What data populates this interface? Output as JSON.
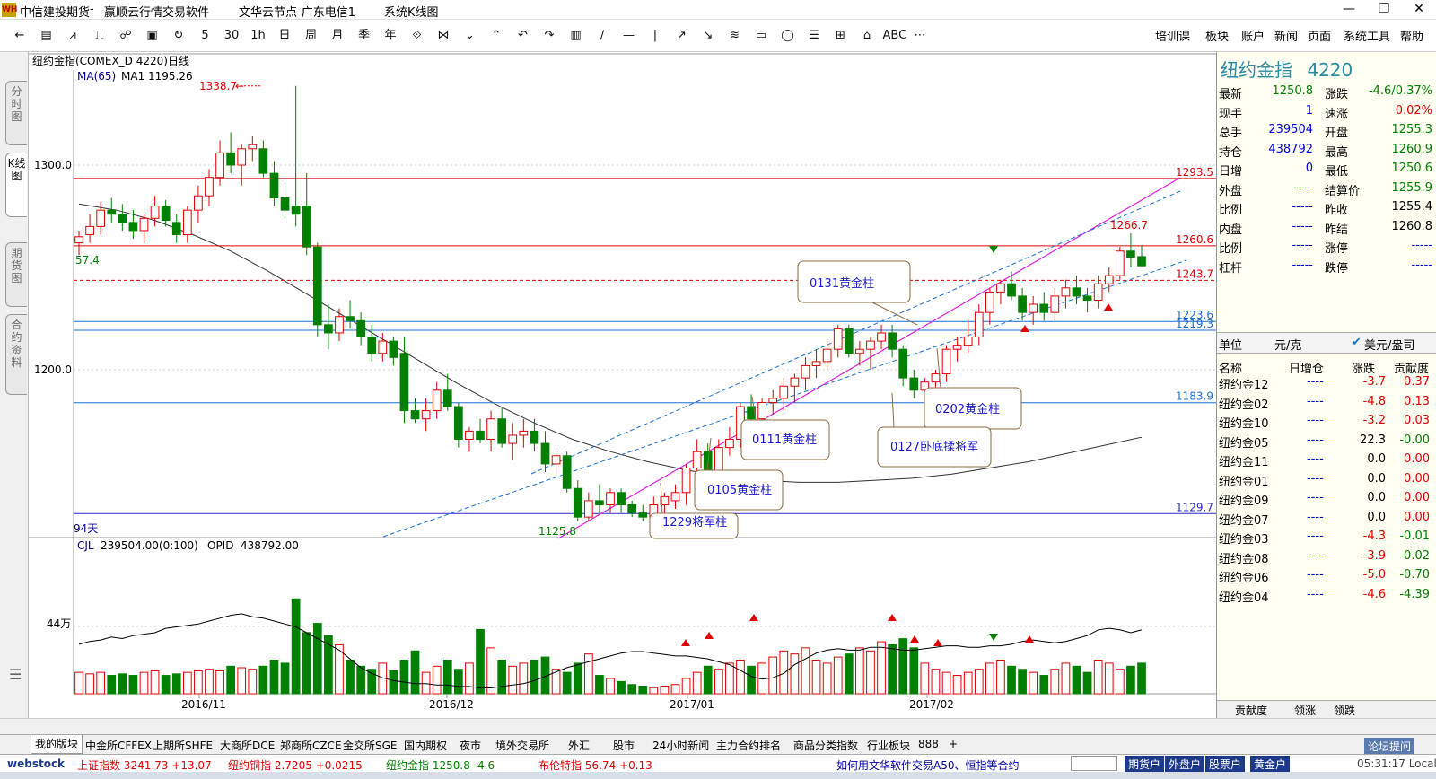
{
  "window": {
    "title_app": "中信建投期货",
    "title_sep": "-",
    "title_soft": "赢顺云行情交易软件",
    "title_node": "文华云节点-广东电信1",
    "title_sys": "系统K线图",
    "logo_text": "WH"
  },
  "toolbar": {
    "tools": [
      "←",
      "▤",
      "⩘",
      "⎍",
      "☍",
      "▣",
      "↻",
      "5",
      "30",
      "1h",
      "日",
      "周",
      "月",
      "季",
      "年",
      "⟐",
      "⋈",
      "⌄",
      "⌃",
      "↶",
      "↷",
      "▥",
      "∕",
      "—",
      "|",
      "↗",
      "↘",
      "≋",
      "▭",
      "◯",
      "☰",
      "⊞",
      "⌂",
      "ABC",
      "⋯"
    ],
    "menus": [
      "培训课",
      "板块",
      "账户",
      "新闻",
      "页面",
      "系统工具",
      "帮助"
    ]
  },
  "left_tabs": [
    "分时图",
    "K线图",
    "期货图",
    "合约资料"
  ],
  "chart": {
    "header": "纽约金指(COMEX_D 4220)日线",
    "ma_label": "MA(65)",
    "ma_value": "MA1 1195.26",
    "volume_label": "CJL",
    "volume_value": "239504.00(0:100)",
    "opid_label": "OPID",
    "opid_value": "438792.00",
    "vol_axis_label": "44万",
    "days_label": "94天",
    "price_axis": [
      "1300.0",
      "1200.0"
    ],
    "left_partial_label": "57.4",
    "high_label": "1338.7",
    "low_label": "1125.8",
    "recent_high_label": "1266.7",
    "hlines": [
      {
        "label": "1293.5",
        "value": 1293.5,
        "color": "#e00000",
        "style": "solid"
      },
      {
        "label": "1260.6",
        "value": 1260.6,
        "color": "#e00000",
        "style": "solid"
      },
      {
        "label": "1243.7",
        "value": 1243.7,
        "color": "#e00000",
        "style": "dash"
      },
      {
        "label": "1223.6",
        "value": 1223.6,
        "color": "#1a6fd6",
        "style": "solid"
      },
      {
        "label": "1219.3",
        "value": 1219.3,
        "color": "#1a6fd6",
        "style": "solid"
      },
      {
        "label": "1183.9",
        "value": 1183.9,
        "color": "#1a6fd6",
        "style": "solid"
      },
      {
        "label": "1129.7",
        "value": 1129.7,
        "color": "#2a2ad0",
        "style": "solid"
      }
    ],
    "annotations": [
      "0131黄金柱",
      "0202黄金柱",
      "0127卧底揉将军",
      "0111黄金柱",
      "0105黄金柱",
      "1229将军柱"
    ],
    "x_labels": [
      "2016/11",
      "2016/12",
      "2017/01",
      "2017/02"
    ]
  },
  "quote": {
    "name": "纽约金指",
    "code": "4220",
    "left": [
      {
        "label": "最新",
        "value": "1250.8",
        "color": "#008000"
      },
      {
        "label": "现手",
        "value": "1",
        "color": "#0000e0"
      },
      {
        "label": "总手",
        "value": "239504",
        "color": "#0000e0"
      },
      {
        "label": "持仓",
        "value": "438792",
        "color": "#0000e0"
      },
      {
        "label": "日增",
        "value": "0",
        "color": "#0000e0"
      },
      {
        "label": "外盘",
        "value": "-----",
        "color": "#0000e0"
      },
      {
        "label": "比例",
        "value": "-----",
        "color": "#0000e0"
      },
      {
        "label": "内盘",
        "value": "-----",
        "color": "#0000e0"
      },
      {
        "label": "比例",
        "value": "-----",
        "color": "#0000e0"
      },
      {
        "label": "杠杆",
        "value": "-----",
        "color": "#0000e0"
      }
    ],
    "right": [
      {
        "label": "涨跌",
        "value": "-4.6/0.37%",
        "color": "#008000"
      },
      {
        "label": "速涨",
        "value": "0.02%",
        "color": "#e00000"
      },
      {
        "label": "开盘",
        "value": "1255.3",
        "color": "#008000"
      },
      {
        "label": "最高",
        "value": "1260.9",
        "color": "#008000"
      },
      {
        "label": "最低",
        "value": "1250.6",
        "color": "#008000"
      },
      {
        "label": "结算价",
        "value": "1255.9",
        "color": "#008000"
      },
      {
        "label": "昨收",
        "value": "1255.4",
        "color": "#000000"
      },
      {
        "label": "昨结",
        "value": "1260.8",
        "color": "#000000"
      },
      {
        "label": "涨停",
        "value": "-----",
        "color": "#0000e0"
      },
      {
        "label": "跌停",
        "value": "-----",
        "color": "#0000e0"
      }
    ],
    "unit_label": "单位",
    "unit_value": "元/克",
    "unit_usd": "美元/盎司",
    "table_headers": [
      "名称",
      "日增仓",
      "涨跌",
      "贡献度"
    ],
    "contracts": [
      {
        "name": "纽约金12",
        "oi": "----",
        "chg": "-3.7",
        "contrib": "0.37"
      },
      {
        "name": "纽约金02",
        "oi": "----",
        "chg": "-4.8",
        "contrib": "0.13"
      },
      {
        "name": "纽约金10",
        "oi": "----",
        "chg": "-3.2",
        "contrib": "0.03"
      },
      {
        "name": "纽约金05",
        "oi": "----",
        "chg": "22.3",
        "contrib": "-0.00"
      },
      {
        "name": "纽约金11",
        "oi": "----",
        "chg": "0.0",
        "contrib": "0.00"
      },
      {
        "name": "纽约金01",
        "oi": "----",
        "chg": "0.0",
        "contrib": "0.00"
      },
      {
        "name": "纽约金09",
        "oi": "----",
        "chg": "0.0",
        "contrib": "0.00"
      },
      {
        "name": "纽约金07",
        "oi": "----",
        "chg": "0.0",
        "contrib": "0.00"
      },
      {
        "name": "纽约金03",
        "oi": "----",
        "chg": "-4.3",
        "contrib": "-0.01"
      },
      {
        "name": "纽约金08",
        "oi": "----",
        "chg": "-3.9",
        "contrib": "-0.02"
      },
      {
        "name": "纽约金06",
        "oi": "----",
        "chg": "-5.0",
        "contrib": "-0.70"
      },
      {
        "name": "纽约金04",
        "oi": "----",
        "chg": "-4.6",
        "contrib": "-4.39"
      }
    ],
    "bottom_tabs": [
      "贡献度",
      "领涨",
      "领跌"
    ]
  },
  "bottom_tabs": [
    "我的版块",
    "中金所CFFEX",
    "上期所SHFE",
    "大商所DCE",
    "郑商所CZCE",
    "金交所SGE",
    "国内期权",
    "夜市",
    "境外交易所",
    "外汇",
    "股市",
    "24小时新闻",
    "主力合约排名",
    "商品分类指数",
    "行业板块",
    "888",
    "+"
  ],
  "status": {
    "brand": "webstock",
    "items": [
      {
        "label": "上证指数",
        "value": "3241.73",
        "chg": "+13.07"
      },
      {
        "label": "纽约铜指",
        "value": "2.7205",
        "chg": "+0.0215"
      },
      {
        "label": "纽约金指",
        "value": "1250.8",
        "chg": "-4.6"
      },
      {
        "label": "布伦特指",
        "value": "56.74",
        "chg": "+0.13"
      }
    ],
    "news": "如何用文华软件交易A50、恒指等合约",
    "buttons": [
      "期货户",
      "外盘户",
      "股票户",
      "黄金户"
    ],
    "forum": "论坛提问",
    "time": "05:31:17 Local"
  }
}
